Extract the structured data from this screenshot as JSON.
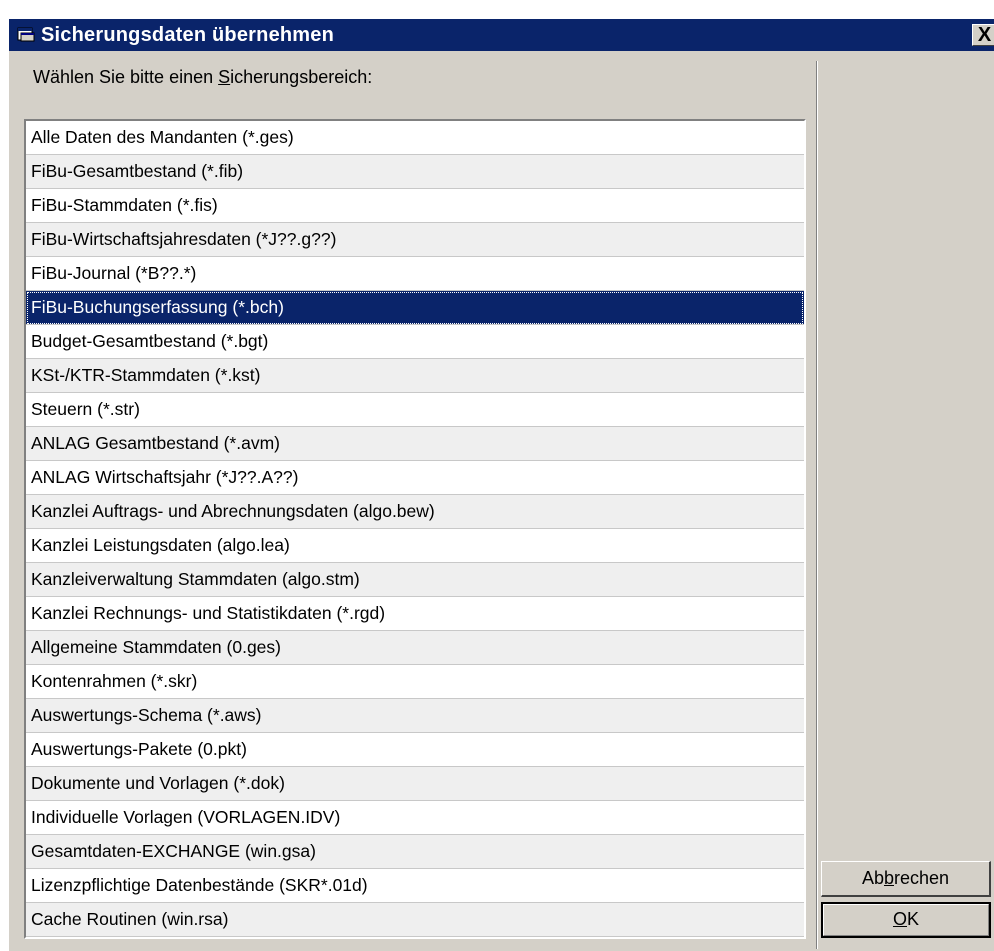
{
  "window": {
    "title": "Sicherungsdaten übernehmen",
    "close_label": "X",
    "titlebar_color": "#0a246a",
    "face_color": "#d4d0c8"
  },
  "prompt": "Wählen Sie bitte einen Sicherungsbereich:",
  "list": {
    "selected_index": 5,
    "items": [
      "Alle Daten des Mandanten (*.ges)",
      "FiBu-Gesamtbestand (*.fib)",
      "FiBu-Stammdaten (*.fis)",
      "FiBu-Wirtschaftsjahresdaten (*J??.g??)",
      "FiBu-Journal (*B??.*)",
      "FiBu-Buchungserfassung (*.bch)",
      "Budget-Gesamtbestand (*.bgt)",
      "KSt-/KTR-Stammdaten (*.kst)",
      "Steuern (*.str)",
      "ANLAG Gesamtbestand (*.avm)",
      "ANLAG Wirtschaftsjahr (*J??.A??)",
      "Kanzlei Auftrags- und Abrechnungsdaten (algo.bew)",
      "Kanzlei Leistungsdaten (algo.lea)",
      "Kanzleiverwaltung Stammdaten (algo.stm)",
      "Kanzlei Rechnungs- und Statistikdaten (*.rgd)",
      "Allgemeine Stammdaten (0.ges)",
      "Kontenrahmen (*.skr)",
      "Auswertungs-Schema (*.aws)",
      "Auswertungs-Pakete (0.pkt)",
      "Dokumente und Vorlagen (*.dok)",
      "Individuelle Vorlagen (VORLAGEN.IDV)",
      "Gesamtdaten-EXCHANGE (win.gsa)",
      "Lizenzpflichtige Datenbestände (SKR*.01d)",
      "Cache Routinen (win.rsa)"
    ]
  },
  "buttons": {
    "cancel_label": "Abbrechen",
    "ok_label": "OK"
  },
  "icons": {
    "app": "folder-window-icon",
    "close": "close-icon"
  }
}
